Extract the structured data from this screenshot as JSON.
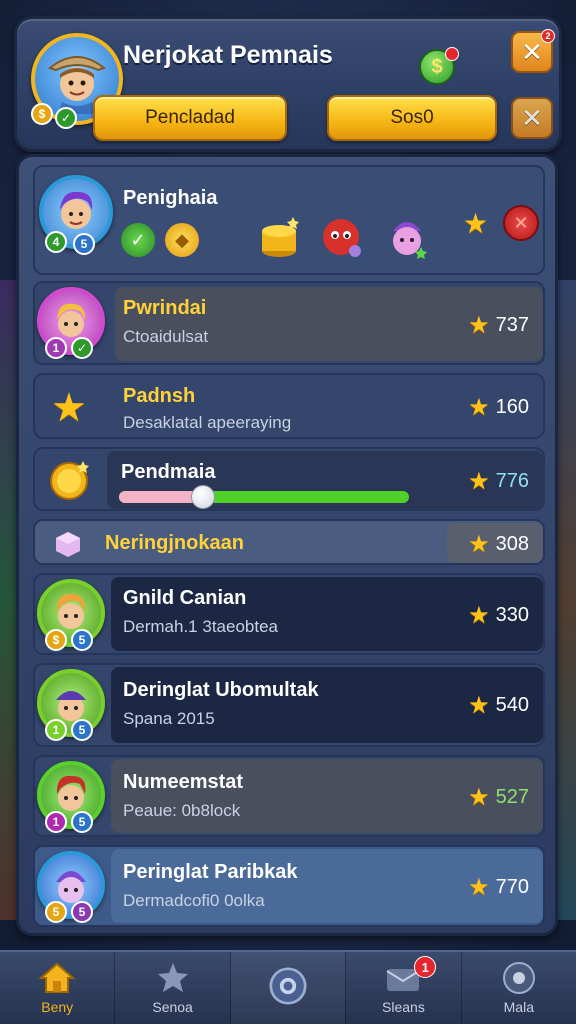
{
  "header": {
    "title": "Nerjokat Pemnais",
    "button_left": "Pencladad",
    "button_right": "Sos0",
    "notif_count": "2",
    "coin_symbol": "$",
    "avatar_badges": [
      "$",
      "✓"
    ]
  },
  "player": {
    "name": "Penighaia",
    "badges": [
      "4",
      "5"
    ],
    "chips": [
      "✓",
      "◆"
    ]
  },
  "rows": [
    {
      "title": "Pwrindai",
      "sub": "Ctoaidulsat",
      "score": "737",
      "badges": [
        "1",
        "✓"
      ]
    },
    {
      "title": "Padnsh",
      "sub": "Desaklatal apeeraying",
      "score": "160"
    },
    {
      "title": "Pendmaia",
      "score": "776",
      "progress": 0.29
    },
    {
      "title": "Neringjnokaan",
      "score": "308"
    },
    {
      "title": "Gnild Canian",
      "sub": "Dermah.1 3taeobtea",
      "score": "330",
      "badges": [
        "$",
        "5"
      ]
    },
    {
      "title": "Deringlat Ubomultak",
      "sub": "Spana 2015",
      "score": "540",
      "badges": [
        "1",
        "5"
      ]
    },
    {
      "title": "Numeemstat",
      "sub": "Peaue: 0b8lock",
      "score": "527",
      "badges": [
        "1",
        "5"
      ]
    },
    {
      "title": "Peringlat Paribkak",
      "sub": "Dermadcofi0 0olka",
      "score": "770",
      "badges": [
        "5",
        "5"
      ]
    }
  ],
  "nav": {
    "items": [
      {
        "label": "Beny"
      },
      {
        "label": "Senoa"
      },
      {
        "label": ""
      },
      {
        "label": "Sleans",
        "badge": "1"
      },
      {
        "label": "Mala"
      }
    ]
  },
  "colors": {
    "accent_gold": "#ffc21a",
    "button_yellow": "#f6b513",
    "close_orange": "#e0861d",
    "progress_green": "#4fd12a",
    "progress_pink": "#f5b3c8"
  }
}
